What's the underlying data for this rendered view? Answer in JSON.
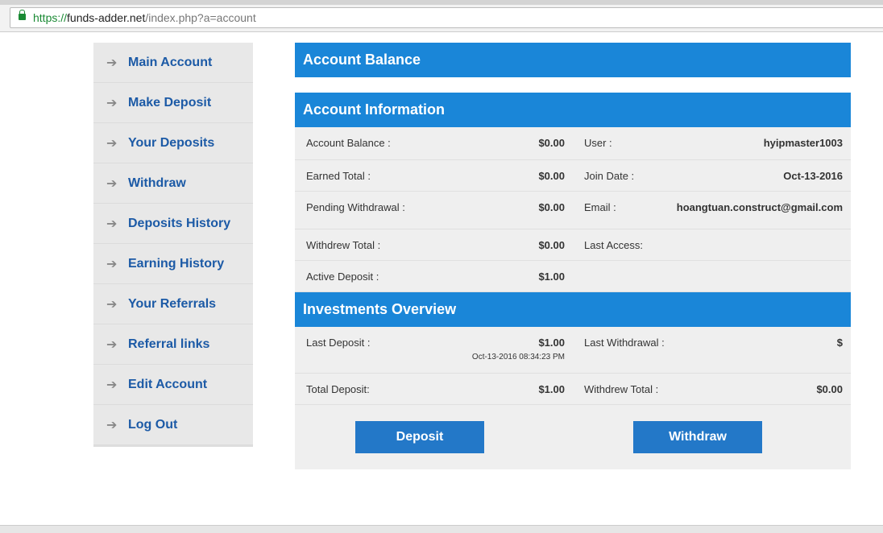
{
  "browser": {
    "url_scheme": "https://",
    "url_host": "funds-adder.net",
    "url_path": "/index.php?a=account"
  },
  "sidebar": {
    "items": [
      {
        "label": "Main Account"
      },
      {
        "label": "Make Deposit"
      },
      {
        "label": "Your Deposits"
      },
      {
        "label": "Withdraw"
      },
      {
        "label": "Deposits History"
      },
      {
        "label": "Earning History"
      },
      {
        "label": "Your Referrals"
      },
      {
        "label": "Referral links"
      },
      {
        "label": "Edit Account"
      },
      {
        "label": "Log Out"
      }
    ]
  },
  "balance": {
    "title": "Account Balance"
  },
  "info": {
    "title": "Account Information",
    "rows": [
      {
        "l1": "Account Balance :",
        "v1": "$0.00",
        "l2": "User :",
        "v2": "hyipmaster1003"
      },
      {
        "l1": "Earned Total :",
        "v1": "$0.00",
        "l2": "Join Date :",
        "v2": "Oct-13-2016"
      },
      {
        "l1": "Pending Withdrawal :",
        "v1": "$0.00",
        "l2": "Email :",
        "v2": "hoangtuan.construct@gmail.com"
      },
      {
        "l1": "Withdrew Total :",
        "v1": "$0.00",
        "l2": "Last Access:",
        "v2": ""
      },
      {
        "l1": "Active Deposit :",
        "v1": "$1.00",
        "l2": "",
        "v2": ""
      }
    ]
  },
  "investments": {
    "title": "Investments Overview",
    "last_deposit_label": "Last Deposit :",
    "last_deposit_value": "$1.00",
    "last_deposit_date": "Oct-13-2016 08:34:23 PM",
    "last_withdrawal_label": "Last Withdrawal :",
    "last_withdrawal_value": "$",
    "total_deposit_label": "Total Deposit:",
    "total_deposit_value": "$1.00",
    "withdrew_total_label": "Withdrew Total :",
    "withdrew_total_value": "$0.00",
    "deposit_button": "Deposit",
    "withdraw_button": "Withdraw"
  }
}
